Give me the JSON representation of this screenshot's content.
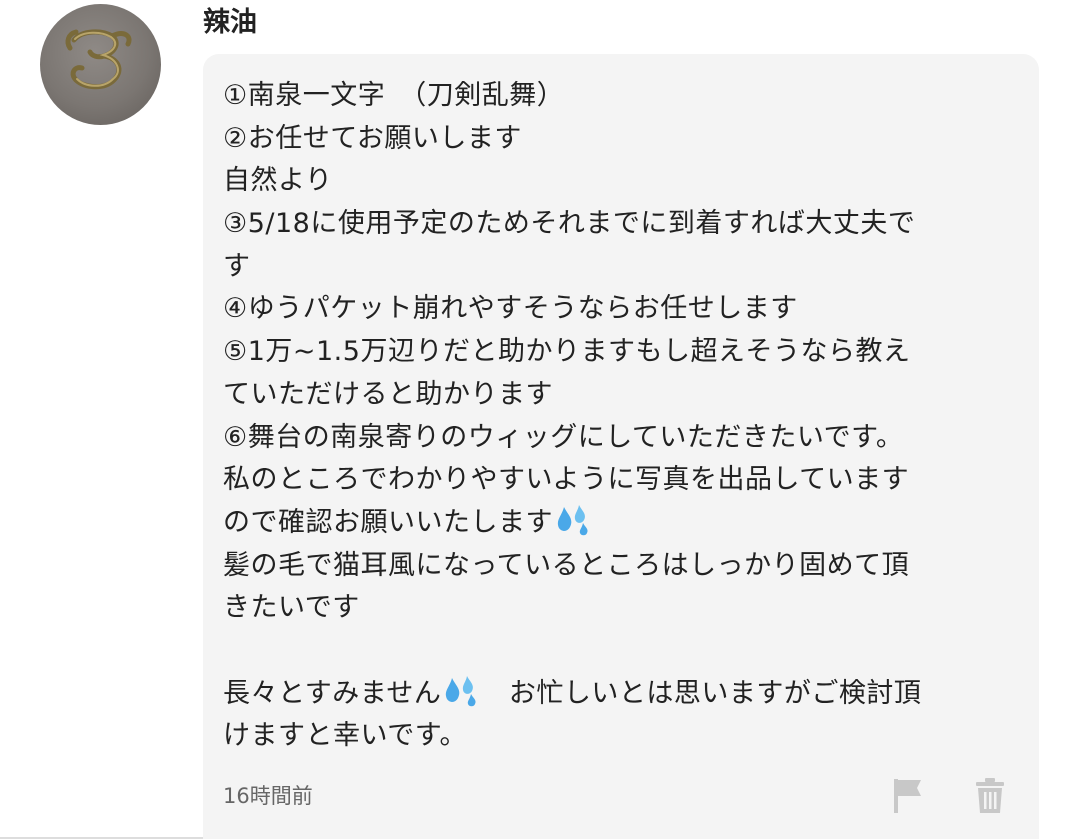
{
  "comment": {
    "username": "辣油",
    "avatar": "ornamental-letter-avatar",
    "message_lines": [
      "①南泉一文字　（刀剣乱舞）",
      "②お任せてお願いします",
      "自然より",
      "③5/18に使用予定のためそれまでに到着すれば大丈夫で",
      "す",
      "④ゆうパケット崩れやすそうならお任せします",
      "⑤1万~1.5万辺りだと助かりますもし超えそうなら教え",
      "ていただけると助かります",
      "⑥舞台の南泉寄りのウィッグにしていただきたいです。",
      "私のところでわかりやすいように写真を出品しています",
      "ので確認お願いいたします",
      "髪の毛で猫耳風になっているところはしっかり固めて頂",
      "きたいです",
      "",
      "長々とすみません",
      "　お忙しいとは思いますがご検討頂",
      "けますと幸いです。"
    ],
    "timestamp": "16時間前",
    "icons": {
      "sweat_drops": "sweat-drops-icon",
      "flag": "flag-icon",
      "trash": "trash-icon"
    },
    "colors": {
      "bubble_bg": "#f4f4f4",
      "text": "#222222",
      "muted": "#666666",
      "icon": "#c8c8c8",
      "drops": "#4aa8e8"
    }
  }
}
